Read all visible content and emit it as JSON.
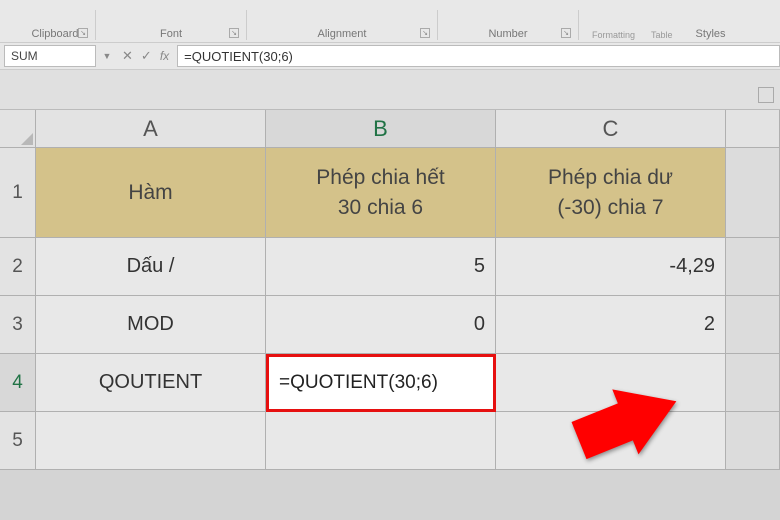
{
  "ribbon": {
    "groups": [
      "Clipboard",
      "Font",
      "Alignment",
      "Number",
      "Styles"
    ],
    "formatting_label": "Formatting",
    "table_label": "Table"
  },
  "formula_bar": {
    "name_box": "SUM",
    "cancel": "✕",
    "enter": "✓",
    "fx": "fx",
    "formula": "=QUOTIENT(30;6)"
  },
  "columns": [
    "A",
    "B",
    "C"
  ],
  "rows": [
    "1",
    "2",
    "3",
    "4",
    "5"
  ],
  "table": {
    "header": {
      "A": "Hàm",
      "B_line1": "Phép chia hết",
      "B_line2": "30 chia 6",
      "C_line1": "Phép chia dư",
      "C_line2": "(-30) chia 7"
    },
    "r2": {
      "A": "Dấu /",
      "B": "5",
      "C": "-4,29"
    },
    "r3": {
      "A": "MOD",
      "B": "0",
      "C": "2"
    },
    "r4": {
      "A": "QOUTIENT",
      "B": "=QUOTIENT(30;6)",
      "C": ""
    },
    "r5": {
      "A": "",
      "B": "",
      "C": ""
    }
  }
}
